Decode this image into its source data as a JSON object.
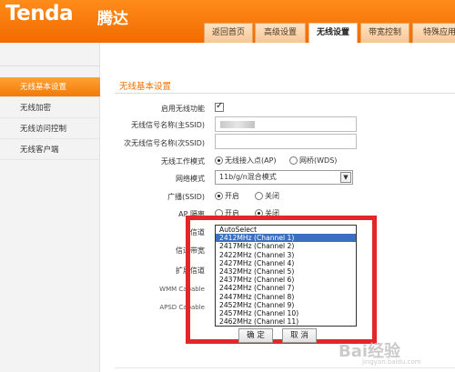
{
  "header": {
    "logo": "Tenda",
    "logo_cn": "腾达",
    "tabs": [
      {
        "label": "返回首页"
      },
      {
        "label": "高级设置"
      },
      {
        "label": "无线设置"
      },
      {
        "label": "带宽控制"
      },
      {
        "label": "特殊应用"
      }
    ],
    "active_tab": "无线设置"
  },
  "sidebar": {
    "items": [
      {
        "label": "无线基本设置"
      },
      {
        "label": "无线加密"
      },
      {
        "label": "无线访问控制"
      },
      {
        "label": "无线客户端"
      }
    ]
  },
  "main": {
    "section_title": "无线基本设置",
    "enable_wireless_label": "启用无线功能",
    "enable_wireless": true,
    "ssid_label": "无线信号名称(主SSID)",
    "ssid2_label": "次无线信号名称(次SSID)",
    "ssid2_value": "",
    "mode_label": "无线工作模式",
    "mode_options": [
      "无线接入点(AP)",
      "网桥(WDS)"
    ],
    "mode_selected": "无线接入点(AP)",
    "netmode_label": "网络模式",
    "netmode_value": "11b/g/n混合模式",
    "broadcast_label": "广播(SSID)",
    "broadcast_options": [
      "开启",
      "关闭"
    ],
    "broadcast_selected": "开启",
    "ap_isolation_label": "AP 隔离",
    "ap_isolation_options": [
      "开启",
      "关闭"
    ],
    "ap_isolation_selected": "关闭",
    "channel_label": "信道",
    "bandwidth_label": "信道带宽",
    "ext_channel_label": "扩展信道",
    "wmm_label": "WMM Capable",
    "apsd_label": "APSD Capable",
    "channel_options": [
      "AutoSelect",
      "2412MHz (Channel 1)",
      "2417MHz (Channel 2)",
      "2422MHz (Channel 3)",
      "2427MHz (Channel 4)",
      "2432MHz (Channel 5)",
      "2437MHz (Channel 6)",
      "2442MHz (Channel 7)",
      "2447MHz (Channel 8)",
      "2452MHz (Channel 9)",
      "2457MHz (Channel 10)",
      "2462MHz (Channel 11)"
    ],
    "channel_highlighted": "2412MHz (Channel 1)",
    "ok_label": "确 定",
    "cancel_label": "取 消"
  },
  "watermark": {
    "text": "Bai经验",
    "sub": "jingyan.baidu.com"
  },
  "colors": {
    "accent": "#f26b00",
    "highlight_box": "#e3262b",
    "selected_item": "#3b6fbf"
  }
}
